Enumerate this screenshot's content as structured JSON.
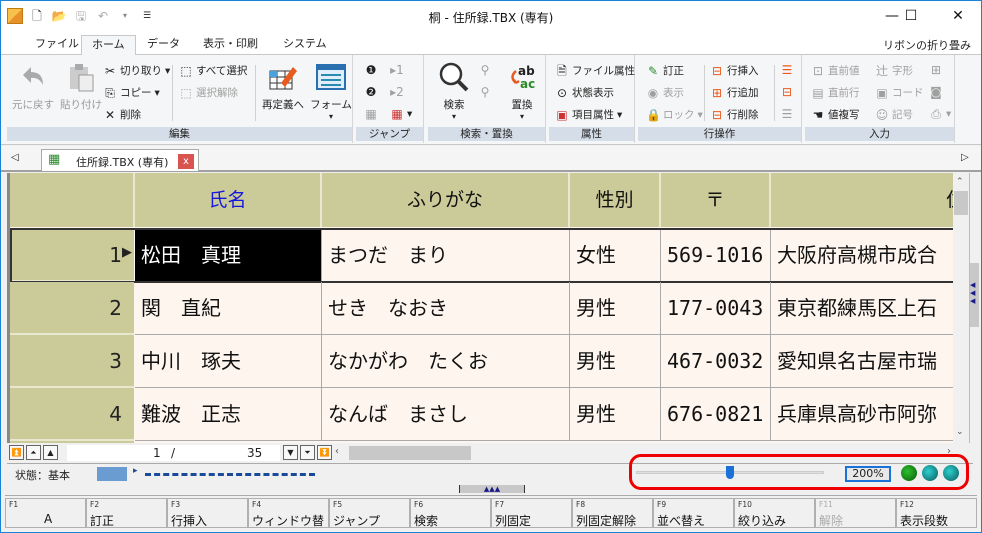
{
  "window": {
    "title": "桐 - 住所録.TBX (専有)",
    "minimize": "—",
    "maximize": "☐",
    "close": "✕"
  },
  "qat": {
    "icons": [
      "app-icon",
      "new-file-icon",
      "open-folder-icon",
      "save-icon",
      "undo-icon",
      "dropdown-icon",
      "customize-icon"
    ]
  },
  "ribbon_tabs": [
    "ファイル",
    "ホーム",
    "データ",
    "表示・印刷",
    "システム"
  ],
  "active_tab": "ホーム",
  "ribbon_collapse": "リボンの折り畳み",
  "groups": {
    "edit": {
      "label": "編集",
      "undo": "元に戻す",
      "paste": "貼り付け",
      "cut": "切り取り",
      "copy": "コピー",
      "delete": "削除",
      "select_all": "すべて選択",
      "deselect": "選択解除",
      "redefine": "再定義へ",
      "form": "フォーム"
    },
    "jump": {
      "label": "ジャンプ"
    },
    "search": {
      "label": "検索・置換",
      "search": "検索",
      "replace": "置換"
    },
    "attr": {
      "label": "属性",
      "file_attr": "ファイル属性",
      "status_view": "状態表示",
      "item_attr": "項目属性"
    },
    "rowops": {
      "label": "行操作",
      "correct": "訂正",
      "view": "表示",
      "lock": "ロック",
      "row_insert": "行挿入",
      "row_add": "行追加",
      "row_delete": "行削除"
    },
    "input": {
      "label": "入力",
      "prev_value": "直前値",
      "glyph": "字形",
      "prev_row": "直前行",
      "code": "コード",
      "copy_value": "値複写",
      "symbol": "記号"
    }
  },
  "doc_tab": {
    "label": "住所録.TBX (専有)",
    "close": "x"
  },
  "table": {
    "columns": [
      "",
      "氏名",
      "ふりがな",
      "性別",
      "〒",
      "住"
    ],
    "rows": [
      {
        "no": "1",
        "name": "松田　真理",
        "kana": "まつだ　まり",
        "sex": "女性",
        "zip": "569-1016",
        "addr": "大阪府高槻市成合"
      },
      {
        "no": "2",
        "name": "関　直紀",
        "kana": "せき　なおき",
        "sex": "男性",
        "zip": "177-0043",
        "addr": "東京都練馬区上石"
      },
      {
        "no": "3",
        "name": "中川　琢夫",
        "kana": "なかがわ　たくお",
        "sex": "男性",
        "zip": "467-0032",
        "addr": "愛知県名古屋市瑞"
      },
      {
        "no": "4",
        "name": "難波　正志",
        "kana": "なんば　まさし",
        "sex": "男性",
        "zip": "676-0821",
        "addr": "兵庫県高砂市阿弥"
      }
    ],
    "selected_row": 1
  },
  "nav": {
    "current": "1",
    "sep": "/",
    "total": "35"
  },
  "status": {
    "state": "状態：基本",
    "zoom": "200%",
    "zoom_fraction": 0.5
  },
  "fkeys": [
    {
      "key": "F1",
      "label": "A",
      "enabled": true
    },
    {
      "key": "F2",
      "label": "訂正",
      "enabled": true
    },
    {
      "key": "F3",
      "label": "行挿入",
      "enabled": true
    },
    {
      "key": "F4",
      "label": "ウィンドウ替",
      "enabled": true
    },
    {
      "key": "F5",
      "label": "ジャンプ",
      "enabled": true
    },
    {
      "key": "F6",
      "label": "検索",
      "enabled": true
    },
    {
      "key": "F7",
      "label": "列固定",
      "enabled": true
    },
    {
      "key": "F8",
      "label": "列固定解除",
      "enabled": true
    },
    {
      "key": "F9",
      "label": "並べ替え",
      "enabled": true
    },
    {
      "key": "F10",
      "label": "絞り込み",
      "enabled": true
    },
    {
      "key": "F11",
      "label": "解除",
      "enabled": false
    },
    {
      "key": "F12",
      "label": "表示段数",
      "enabled": true
    }
  ],
  "colors": {
    "header_bg": "#cbcb99",
    "cell_bg": "#fdf5ee",
    "accent": "#1883d7",
    "highlight": "#e00000"
  }
}
